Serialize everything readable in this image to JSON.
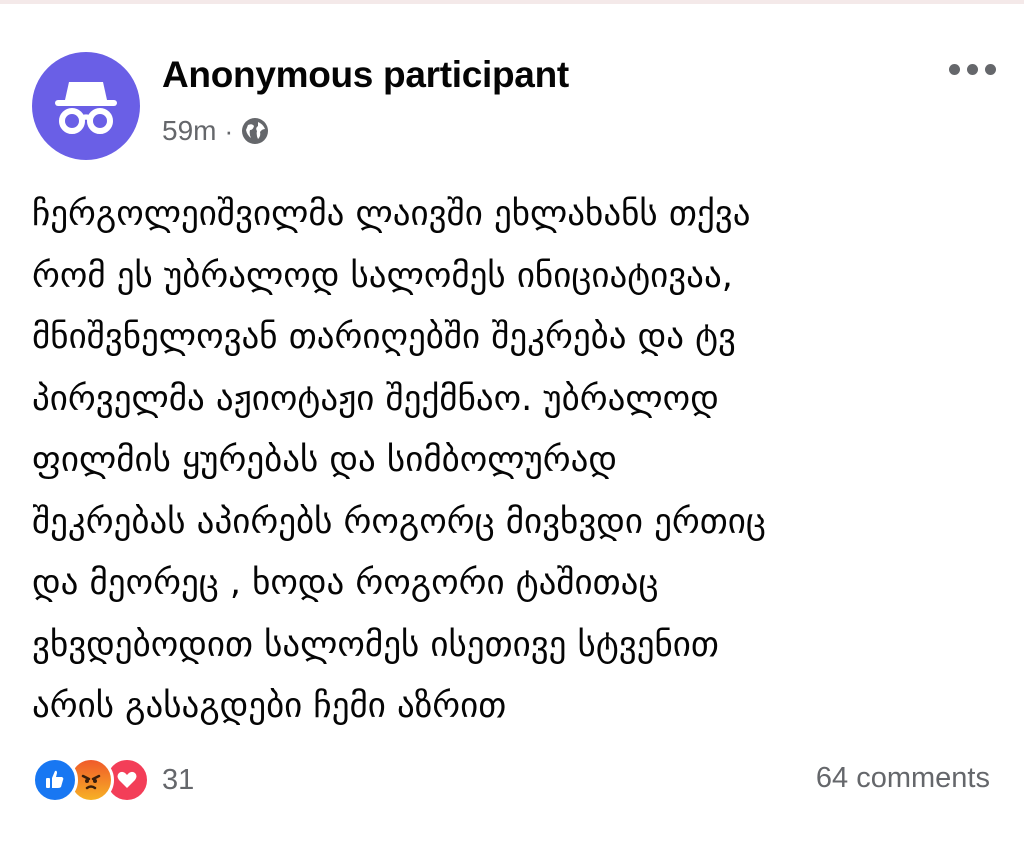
{
  "post": {
    "author": "Anonymous participant",
    "time": "59m",
    "separator": "·",
    "audience_icon": "globe-icon",
    "avatar_icon": "incognito-icon",
    "avatar_color": "#6a5fe6",
    "text_lines": [
      "ჩერგოლეიშვილმა ლაივში ეხლახანს თქვა",
      "რომ ეს უბრალოდ სალომეს ინიციატივაა,",
      "მნიშვნელოვან თარიღებში შეკრება და ტვ",
      "პირველმა აჟიოტაჟი შექმნაო. უბრალოდ",
      "ფილმის ყურებას და სიმბოლურად",
      "შეკრებას აპირებს როგორც მივხვდი ერთიც",
      "და მეორეც , ხოდა როგორი ტაშითაც",
      "ვხვდებოდით სალომეს ისეთივე სტვენით",
      "არის გასაგდები ჩემი აზრით"
    ]
  },
  "reactions": {
    "icons": [
      "like-icon",
      "angry-icon",
      "love-icon"
    ],
    "count": "31"
  },
  "comments_label": "64 comments",
  "colors": {
    "like": "#1877f2",
    "love": "#f33e58",
    "angry": "#f7b125",
    "secondary_text": "#65676b"
  }
}
